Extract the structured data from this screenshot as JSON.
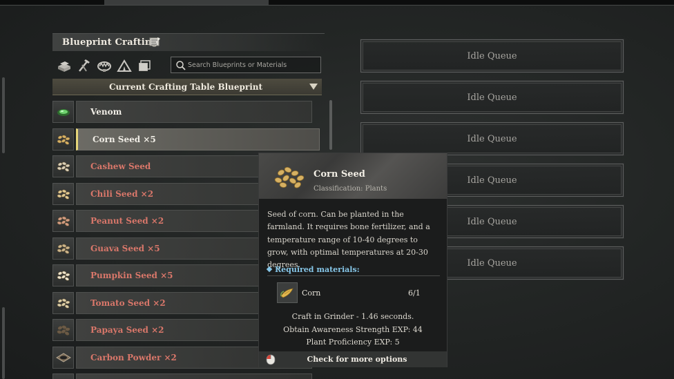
{
  "header": {
    "title": "Blueprint Crafting",
    "title_icon": "blueprint-scroll-icon"
  },
  "categories": [
    {
      "icon": "materials-icon"
    },
    {
      "icon": "tools-icon"
    },
    {
      "icon": "animal-trap-icon"
    },
    {
      "icon": "tent-icon"
    },
    {
      "icon": "storage-icon"
    }
  ],
  "search": {
    "placeholder": "Search Blueprints or Materials",
    "value": ""
  },
  "dropdown": {
    "label": "Current Crafting Table Blueprint"
  },
  "list": {
    "items": [
      {
        "label": "Venom",
        "color": "#f0ede6",
        "icon": "venom-icon",
        "selected": false
      },
      {
        "label": "Corn Seed ×5",
        "color": "#f0ede6",
        "icon": "corn-seed-icon",
        "selected": true
      },
      {
        "label": "Cashew Seed",
        "color": "#d9776a",
        "icon": "cashew-seed-icon",
        "selected": false
      },
      {
        "label": "Chili Seed ×2",
        "color": "#d9776a",
        "icon": "chili-seed-icon",
        "selected": false
      },
      {
        "label": "Peanut Seed ×2",
        "color": "#d9776a",
        "icon": "peanut-seed-icon",
        "selected": false
      },
      {
        "label": "Guava Seed ×5",
        "color": "#d9776a",
        "icon": "guava-seed-icon",
        "selected": false
      },
      {
        "label": "Pumpkin Seed ×5",
        "color": "#d9776a",
        "icon": "pumpkin-seed-icon",
        "selected": false
      },
      {
        "label": "Tomato Seed ×2",
        "color": "#d9776a",
        "icon": "tomato-seed-icon",
        "selected": false
      },
      {
        "label": "Papaya Seed ×2",
        "color": "#d9776a",
        "icon": "papaya-seed-icon",
        "selected": false
      },
      {
        "label": "Carbon Powder ×2",
        "color": "#d9776a",
        "icon": "carbon-powder-icon",
        "selected": false
      },
      {
        "label": "",
        "color": "#d9776a",
        "icon": "item-icon",
        "selected": false
      }
    ]
  },
  "queues": [
    {
      "label": "Idle Queue"
    },
    {
      "label": "Idle Queue"
    },
    {
      "label": "Idle Queue"
    },
    {
      "label": "Idle Queue"
    },
    {
      "label": "Idle Queue"
    },
    {
      "label": "Idle Queue"
    }
  ],
  "tooltip": {
    "name": "Corn Seed",
    "classification": "Classification: Plants",
    "description": "Seed of corn. Can be planted in the farmland. It requires bone fertilizer, and a temperature range of 10-40 degrees to grow, with optimal temperatures at 20-30 degrees.",
    "required_label": "Required materials:",
    "materials": [
      {
        "name": "Corn",
        "count": "6/1",
        "icon": "corn-icon"
      }
    ],
    "stats": [
      "Craft in Grinder - 1.46 seconds.",
      "Obtain Awareness Strength EXP: 44",
      "Plant Proficiency EXP: 5"
    ],
    "footer_label": "Check for more options",
    "footer_icon": "mouse-icon"
  },
  "colors": {
    "accent_selected": "#e6d67a",
    "locked_text": "#d9776a",
    "required_text": "#86c6e8"
  }
}
